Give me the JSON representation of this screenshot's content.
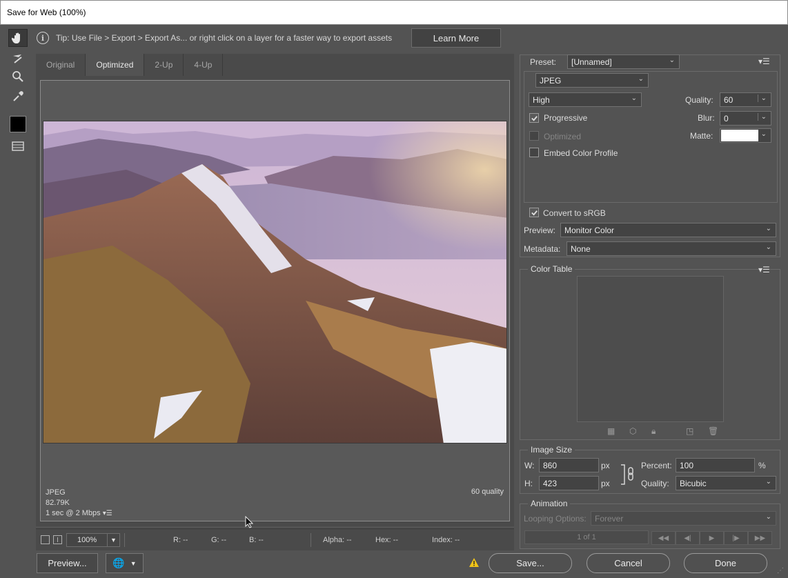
{
  "window": {
    "title": "Save for Web (100%)"
  },
  "tools": {
    "items": [
      "hand-tool",
      "slice-select-tool",
      "zoom-tool",
      "eyedropper-tool",
      "eyedropper-color",
      "toggle-slices-visibility"
    ]
  },
  "tip": {
    "text": "Tip: Use File > Export > Export As...  or right click on a layer for a faster way to export assets",
    "learn_more": "Learn More"
  },
  "tabs": [
    {
      "label": "Original",
      "active": false
    },
    {
      "label": "Optimized",
      "active": true
    },
    {
      "label": "2-Up",
      "active": false
    },
    {
      "label": "4-Up",
      "active": false
    }
  ],
  "preview": {
    "format": "JPEG",
    "size": "82.79K",
    "download_time": "1 sec @ 2 Mbps",
    "quality_label": "60 quality"
  },
  "statusbar": {
    "zoom": "100%",
    "r": "R: --",
    "g": "G: --",
    "b": "B: --",
    "alpha": "Alpha: --",
    "hex": "Hex: --",
    "index": "Index: --"
  },
  "footer": {
    "preview_btn": "Preview...",
    "save_btn": "Save...",
    "cancel_btn": "Cancel",
    "done_btn": "Done"
  },
  "settings": {
    "preset_label": "Preset:",
    "preset_value": "[Unnamed]",
    "format_value": "JPEG",
    "quality_level": "High",
    "quality_label": "Quality:",
    "quality_value": "60",
    "progressive_label": "Progressive",
    "progressive_checked": true,
    "blur_label": "Blur:",
    "blur_value": "0",
    "optimized_label": "Optimized",
    "optimized_checked": false,
    "matte_label": "Matte:",
    "matte_color": "#ffffff",
    "embed_label": "Embed Color Profile",
    "embed_checked": false,
    "srgb_label": "Convert to sRGB",
    "srgb_checked": true,
    "preview_label": "Preview:",
    "preview_value": "Monitor Color",
    "metadata_label": "Metadata:",
    "metadata_value": "None"
  },
  "color_table": {
    "title": "Color Table"
  },
  "image_size": {
    "title": "Image Size",
    "w_label": "W:",
    "w_value": "860",
    "h_label": "H:",
    "h_value": "423",
    "unit": "px",
    "percent_label": "Percent:",
    "percent_value": "100",
    "percent_unit": "%",
    "quality_label": "Quality:",
    "quality_value": "Bicubic"
  },
  "animation": {
    "title": "Animation",
    "looping_label": "Looping Options:",
    "looping_value": "Forever",
    "frame": "1 of 1"
  },
  "colors": {
    "bg": "#535353",
    "panel": "#4a4a4a",
    "accent_warning": "#f0c419"
  }
}
